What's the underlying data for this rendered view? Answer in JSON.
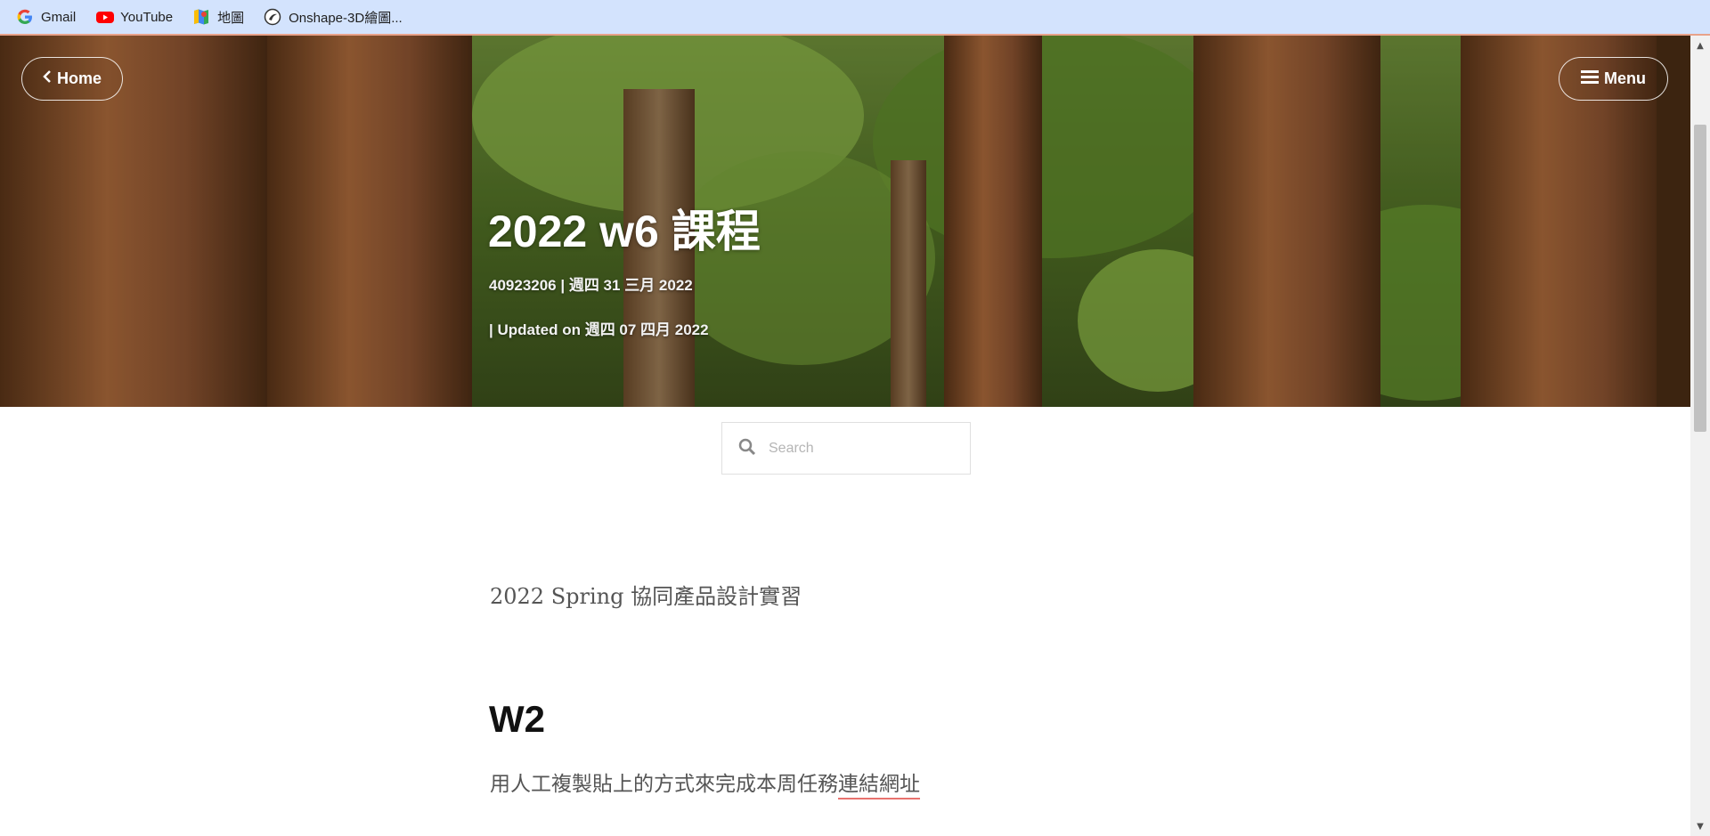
{
  "bookmarks": [
    {
      "label": "Gmail",
      "icon": "google-icon"
    },
    {
      "label": "YouTube",
      "icon": "youtube-icon"
    },
    {
      "label": "地圖",
      "icon": "maps-icon"
    },
    {
      "label": "Onshape-3D繪圖...",
      "icon": "onshape-icon"
    }
  ],
  "nav": {
    "home_label": "Home",
    "menu_label": "Menu"
  },
  "post": {
    "title": "2022 w6 課程",
    "meta_line": "40923206 | 週四 31 三月 2022",
    "updated_line": "| Updated on 週四 07 四月 2022"
  },
  "search": {
    "placeholder": "Search",
    "value": ""
  },
  "content": {
    "intro": "2022 Spring 協同產品設計實習",
    "heading": "W2",
    "body_prefix": "用人工複製貼上的方式來完成本周任務",
    "link_text": "連結網址"
  },
  "colors": {
    "bookmarks_bar": "#d3e3fd",
    "link_underline": "#e8726e",
    "heading_text": "#111111"
  }
}
